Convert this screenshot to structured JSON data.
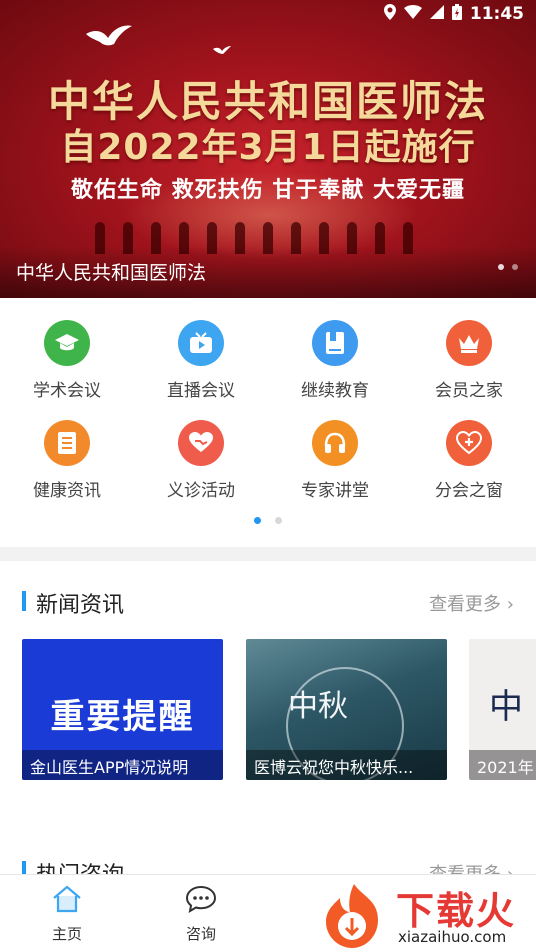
{
  "status_bar": {
    "time": "11:45"
  },
  "banner": {
    "line1": "中华人民共和国医师法",
    "line2": "自2022年3月1日起施行",
    "slogan": "敬佑生命 救死扶伤 甘于奉献 大爱无疆",
    "caption": "中华人民共和国医师法",
    "dots": 2,
    "active_dot": 1
  },
  "grid": {
    "items": [
      {
        "label": "学术会议",
        "icon": "graduation-cap-icon",
        "color": "#3fb44a"
      },
      {
        "label": "直播会议",
        "icon": "tv-icon",
        "color": "#3ea6f0"
      },
      {
        "label": "继续教育",
        "icon": "book-icon",
        "color": "#3f9bef"
      },
      {
        "label": "会员之家",
        "icon": "crown-icon",
        "color": "#f0603a"
      },
      {
        "label": "健康资讯",
        "icon": "document-icon",
        "color": "#f28a2b"
      },
      {
        "label": "义诊活动",
        "icon": "heart-hand-icon",
        "color": "#f05c4b"
      },
      {
        "label": "专家讲堂",
        "icon": "headphones-icon",
        "color": "#f39024"
      },
      {
        "label": "分会之窗",
        "icon": "plus-heart-icon",
        "color": "#f0603a"
      }
    ],
    "pages": 2,
    "active_page": 0
  },
  "news": {
    "title": "新闻资讯",
    "more": "查看更多",
    "cards": [
      {
        "caption": "金山医生APP情况说明",
        "image_text": "重要提醒"
      },
      {
        "caption": "医博云祝您中秋快乐...",
        "image_text": "中秋"
      },
      {
        "caption": "2021年",
        "image_text": "中"
      }
    ]
  },
  "hot": {
    "title": "热门咨询",
    "more": "查看更多"
  },
  "bottom_nav": {
    "items": [
      {
        "label": "主页",
        "icon": "home-icon"
      },
      {
        "label": "咨询",
        "icon": "chat-icon"
      }
    ]
  },
  "watermark": {
    "text": "下载火",
    "sub": "xiazaihuo.com"
  }
}
